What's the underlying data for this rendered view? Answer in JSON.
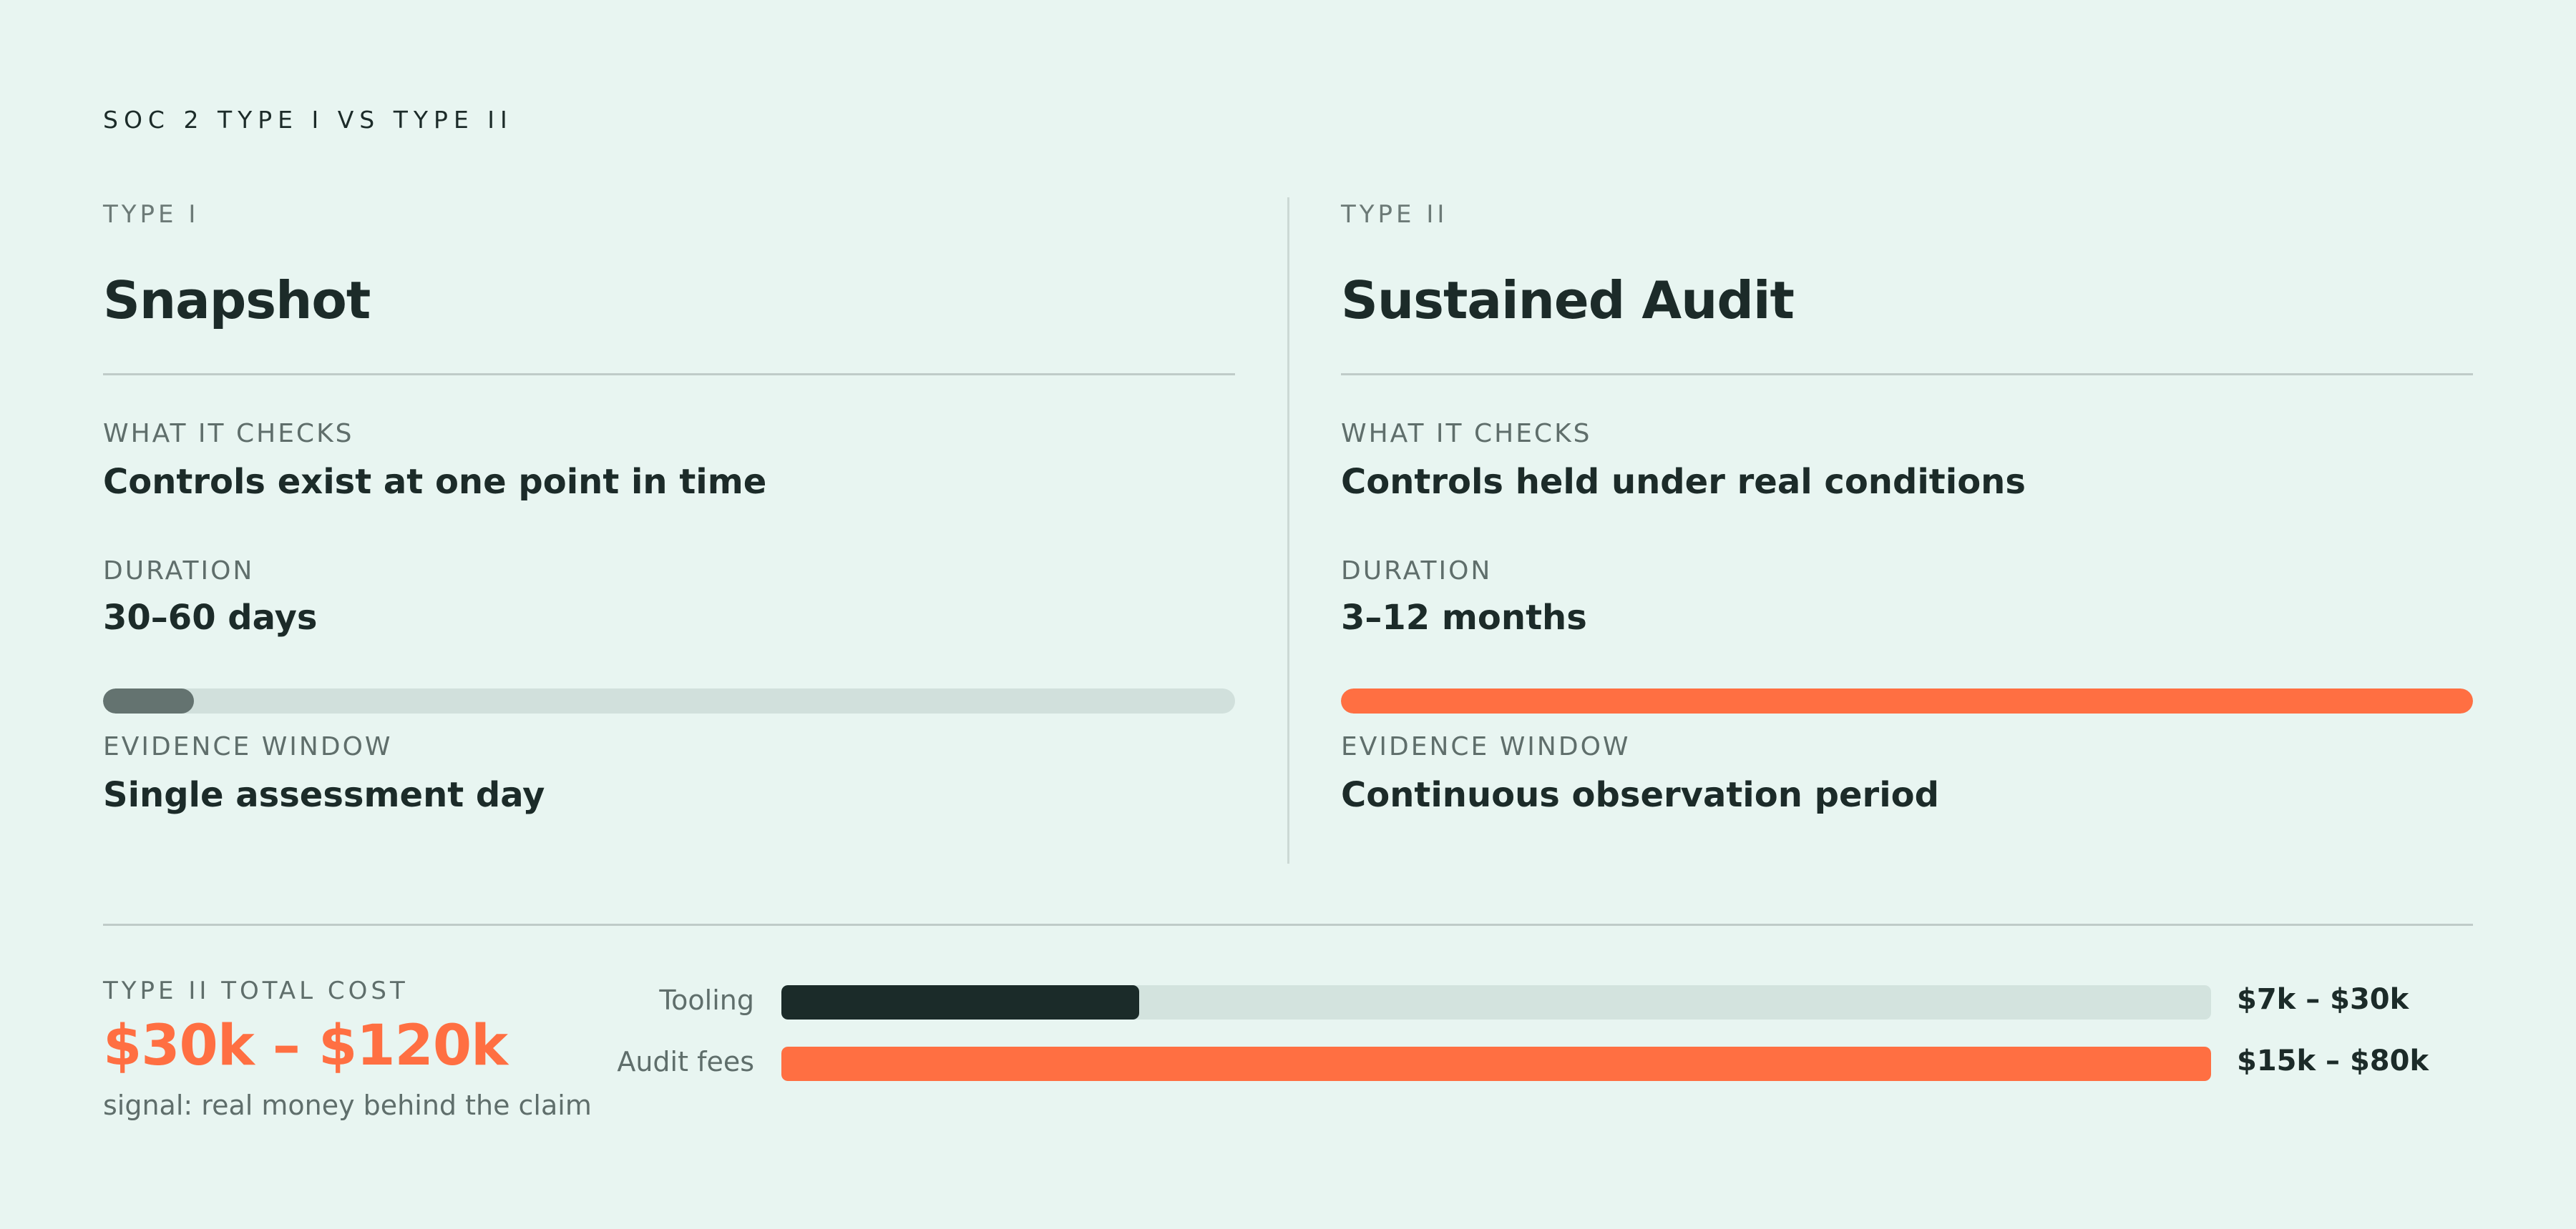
{
  "header": {
    "eyebrow": "SOC 2 TYPE I VS TYPE II"
  },
  "columns": [
    {
      "type_label": "TYPE I",
      "title": "Snapshot",
      "checks_label": "WHAT IT CHECKS",
      "checks_value": "Controls exist at one point in time",
      "duration_label": "DURATION",
      "duration_value": "30–60 days",
      "duration_fill_fraction": 0.08,
      "duration_fill_color": "#647370",
      "evidence_label": "EVIDENCE WINDOW",
      "evidence_value": "Single assessment day"
    },
    {
      "type_label": "TYPE II",
      "title": "Sustained Audit",
      "checks_label": "WHAT IT CHECKS",
      "checks_value": "Controls held under real conditions",
      "duration_label": "DURATION",
      "duration_value": "3–12 months",
      "duration_fill_fraction": 1.0,
      "duration_fill_color": "#ff6f42",
      "evidence_label": "EVIDENCE WINDOW",
      "evidence_value": "Continuous observation period"
    }
  ],
  "cost": {
    "label": "TYPE II TOTAL COST",
    "value": "$30k – $120k",
    "note": "signal: real money behind the claim",
    "rows": [
      {
        "name": "Tooling",
        "value": "$7k – $30k",
        "fill_fraction": 0.25,
        "color": "#1b2b29"
      },
      {
        "name": "Audit fees",
        "value": "$15k – $80k",
        "fill_fraction": 1.0,
        "color": "#ff6f42"
      }
    ]
  },
  "colors": {
    "background": "#e8f5f1",
    "accent": "#ff6f42",
    "text": "#1c2b29",
    "muted": "#5f6e6b"
  }
}
